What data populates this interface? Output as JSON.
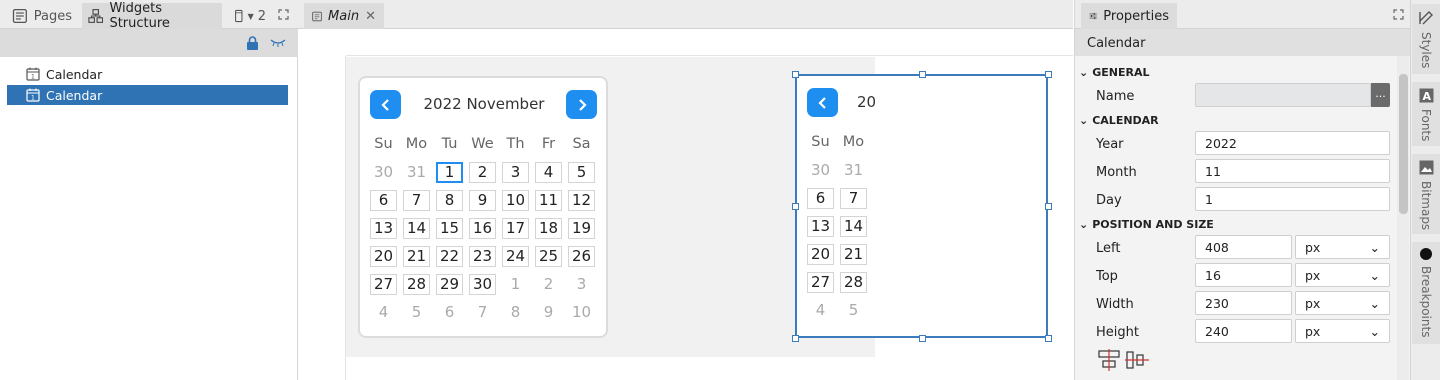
{
  "left_panel": {
    "tabs": [
      {
        "label": "Pages",
        "icon": "pages-icon"
      },
      {
        "label": "Widgets Structure",
        "icon": "widgets-structure-icon"
      },
      {
        "label": "2",
        "icon": "device-icon"
      }
    ],
    "tree": [
      {
        "label": "Calendar",
        "icon": "calendar-icon",
        "selected": false
      },
      {
        "label": "Calendar",
        "icon": "calendar-icon",
        "selected": true
      }
    ]
  },
  "center": {
    "tab_label": "Main",
    "calendar": {
      "title": "2022 November",
      "weekdays": [
        "Su",
        "Mo",
        "Tu",
        "We",
        "Th",
        "Fr",
        "Sa"
      ],
      "weeks": [
        [
          "30",
          "31",
          "1",
          "2",
          "3",
          "4",
          "5"
        ],
        [
          "6",
          "7",
          "8",
          "9",
          "10",
          "11",
          "12"
        ],
        [
          "13",
          "14",
          "15",
          "16",
          "17",
          "18",
          "19"
        ],
        [
          "20",
          "21",
          "22",
          "23",
          "24",
          "25",
          "26"
        ],
        [
          "27",
          "28",
          "29",
          "30",
          "1",
          "2",
          "3"
        ],
        [
          "4",
          "5",
          "6",
          "7",
          "8",
          "9",
          "10"
        ]
      ],
      "selected_day": "1",
      "partial_title": "20"
    }
  },
  "properties": {
    "tab_label": "Properties",
    "header": "Calendar",
    "sections": {
      "general": "GENERAL",
      "calendar": "CALENDAR",
      "position": "POSITION AND SIZE"
    },
    "fields": {
      "name_label": "Name",
      "name_value": "",
      "name_button": "...",
      "year_label": "Year",
      "year_value": "2022",
      "month_label": "Month",
      "month_value": "11",
      "day_label": "Day",
      "day_value": "1",
      "left_label": "Left",
      "left_value": "408",
      "top_label": "Top",
      "top_value": "16",
      "width_label": "Width",
      "width_value": "230",
      "height_label": "Height",
      "height_value": "240",
      "unit": "px"
    }
  },
  "side_tabs": [
    "Styles",
    "Fonts",
    "Bitmaps",
    "Breakpoints"
  ],
  "colors": {
    "accent": "#1f8ef1",
    "selection": "#2f73b5",
    "outline": "#3d7bbf"
  }
}
